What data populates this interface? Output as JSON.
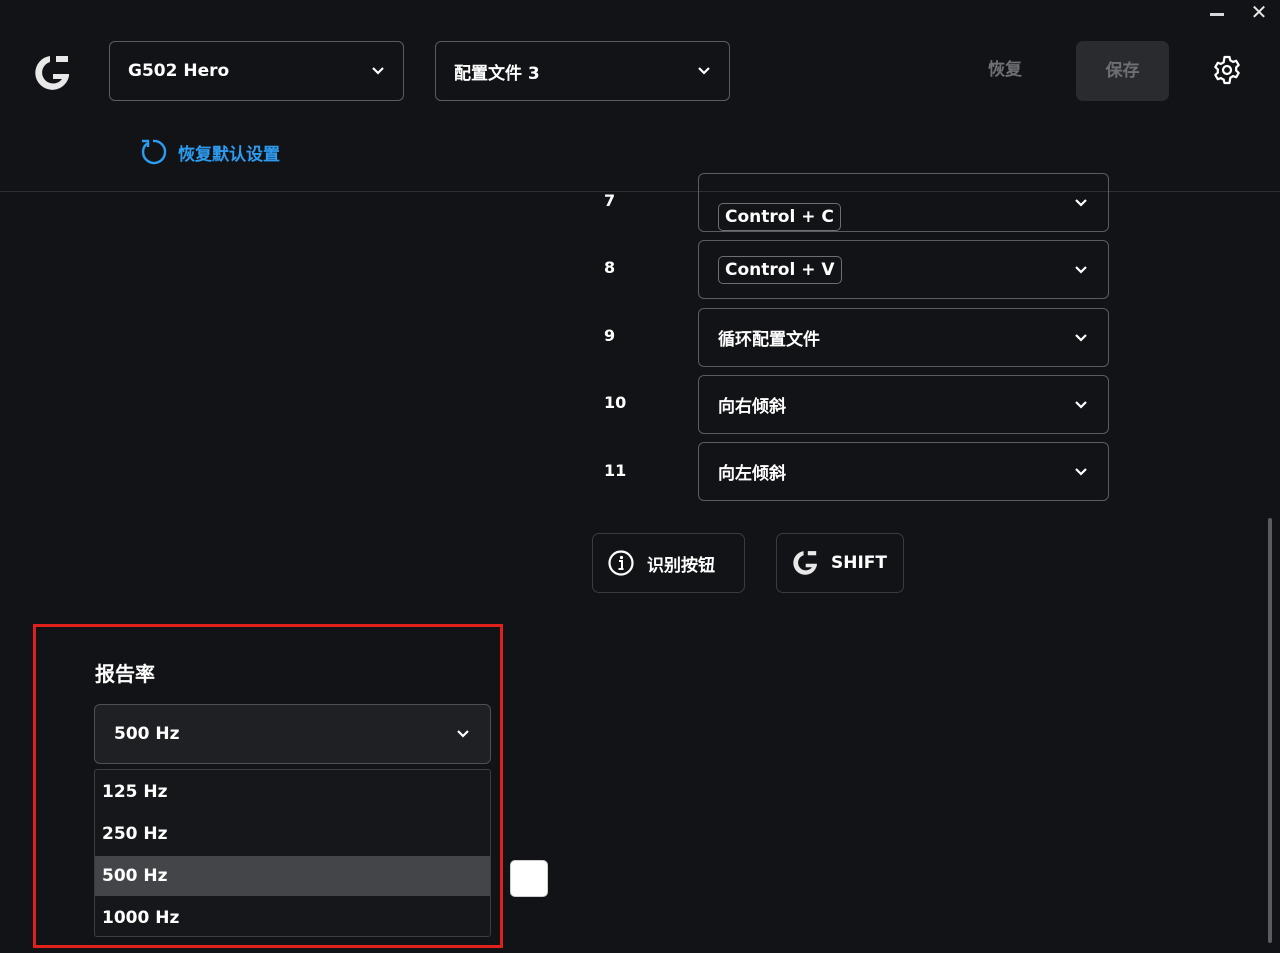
{
  "window": {
    "close_glyph": "✕"
  },
  "header": {
    "device_name": "G502 Hero",
    "profile_name": "配置文件 3",
    "revert_label": "恢复",
    "save_label": "保存",
    "reset_defaults_label": "恢复默认设置"
  },
  "assignments": [
    {
      "number": "7",
      "value": "Control + C",
      "is_keycap": true
    },
    {
      "number": "8",
      "value": "Control + V",
      "is_keycap": true
    },
    {
      "number": "9",
      "value": "循环配置文件",
      "is_keycap": false
    },
    {
      "number": "10",
      "value": "向右倾斜",
      "is_keycap": false
    },
    {
      "number": "11",
      "value": "向左倾斜",
      "is_keycap": false
    }
  ],
  "actions": {
    "identify_label": "识别按钮",
    "shift_label": "SHIFT"
  },
  "report_rate": {
    "title": "报告率",
    "selected": "500 Hz",
    "options": [
      "125 Hz",
      "250 Hz",
      "500 Hz",
      "1000 Hz"
    ]
  },
  "colors": {
    "accent_blue": "#2d9bf0",
    "highlight_red": "#e0201b",
    "background": "#121316"
  },
  "icons": {
    "logo": "logitech-g-logo",
    "settings": "gear-icon",
    "reset": "refresh-icon",
    "identify": "info-icon",
    "shift": "logitech-g-icon",
    "dropdown": "chevron-down-icon"
  }
}
